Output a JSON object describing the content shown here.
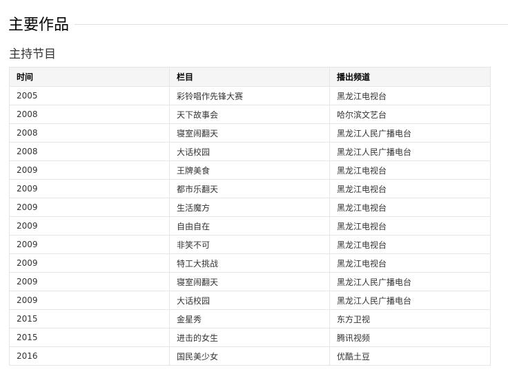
{
  "section": {
    "title": "主要作品"
  },
  "subsection": {
    "title": "主持节目"
  },
  "table": {
    "headers": [
      "时间",
      "栏目",
      "播出频道"
    ],
    "rows": [
      [
        "2005",
        "彩铃唱作先锋大赛",
        "黑龙江电视台"
      ],
      [
        "2008",
        "天下故事会",
        "哈尔滨文艺台"
      ],
      [
        "2008",
        "寝室闹翻天",
        "黑龙江人民广播电台"
      ],
      [
        "2008",
        "大话校园",
        "黑龙江人民广播电台"
      ],
      [
        "2009",
        "王牌美食",
        "黑龙江电视台"
      ],
      [
        "2009",
        "都市乐翻天",
        "黑龙江电视台"
      ],
      [
        "2009",
        "生活魔方",
        "黑龙江电视台"
      ],
      [
        "2009",
        "自由自在",
        "黑龙江电视台"
      ],
      [
        "2009",
        "非笑不可",
        "黑龙江电视台"
      ],
      [
        "2009",
        "特工大挑战",
        "黑龙江电视台"
      ],
      [
        "2009",
        "寝室闹翻天",
        "黑龙江人民广播电台"
      ],
      [
        "2009",
        "大话校园",
        "黑龙江人民广播电台"
      ],
      [
        "2015",
        "金星秀",
        "东方卫视"
      ],
      [
        "2015",
        "进击的女生",
        "腾讯视频"
      ],
      [
        "2016",
        "国民美少女",
        "优酷土豆"
      ]
    ]
  }
}
